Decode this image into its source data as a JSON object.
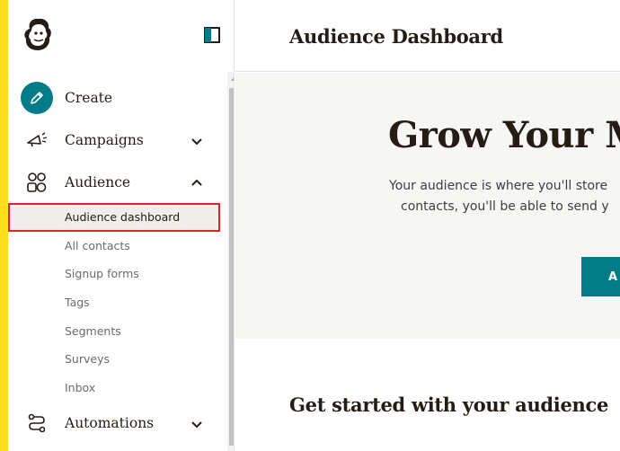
{
  "sidebar": {
    "nav": [
      {
        "label": "Create",
        "icon": "pencil-icon"
      },
      {
        "label": "Campaigns",
        "icon": "megaphone-icon"
      },
      {
        "label": "Audience",
        "icon": "audience-icon"
      }
    ],
    "audience_subitems": [
      {
        "label": "Audience dashboard",
        "active": true
      },
      {
        "label": "All contacts"
      },
      {
        "label": "Signup forms"
      },
      {
        "label": "Tags"
      },
      {
        "label": "Segments"
      },
      {
        "label": "Surveys"
      },
      {
        "label": "Inbox"
      }
    ],
    "bottom_nav": [
      {
        "label": "Automations",
        "icon": "automations-icon"
      }
    ]
  },
  "header": {
    "title": "Audience Dashboard"
  },
  "hero": {
    "title": "Grow Your Ma",
    "text_line1": "Your audience is where you'll store",
    "text_line2": "contacts, you'll be able to send y",
    "cta_label": "A"
  },
  "section": {
    "title": "Get started with your audience"
  },
  "colors": {
    "accent_yellow": "#ffe01b",
    "brand_teal": "#007c89",
    "highlight_red": "#e0202a"
  }
}
